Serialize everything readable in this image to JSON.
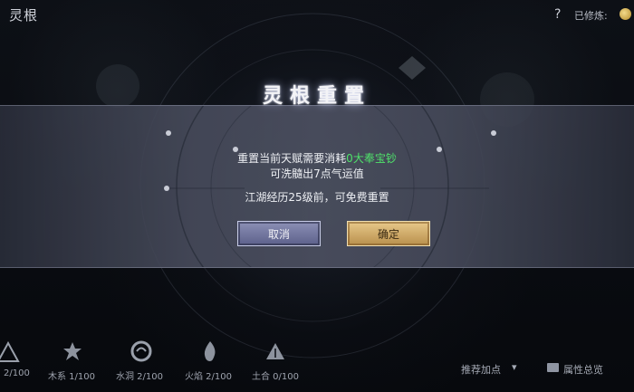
{
  "header": {
    "page_title": "灵根",
    "help_glyph": "?",
    "status_label": "已修炼:"
  },
  "dialog": {
    "title": "灵根重置",
    "line1_prefix": "重置当前天赋需要消耗",
    "cost_amount": "0",
    "cost_currency": "大奉宝钞",
    "line2": "可洗髓出7点气运值",
    "line3": "江湖经历25级前，可免费重置",
    "cancel_label": "取消",
    "confirm_label": "确定",
    "cost_color": "#4fe26a"
  },
  "bottom_bar": {
    "elements": [
      {
        "label": "2/100",
        "icon": "metal-element-icon"
      },
      {
        "label": "木系 1/100",
        "icon": "wood-element-icon"
      },
      {
        "label": "水洞 2/100",
        "icon": "water-element-icon"
      },
      {
        "label": "火焰 2/100",
        "icon": "fire-element-icon"
      },
      {
        "label": "土合 0/100",
        "icon": "earth-element-icon"
      }
    ],
    "recommend_label": "推荐加点",
    "attributes_label": "属性总览"
  }
}
